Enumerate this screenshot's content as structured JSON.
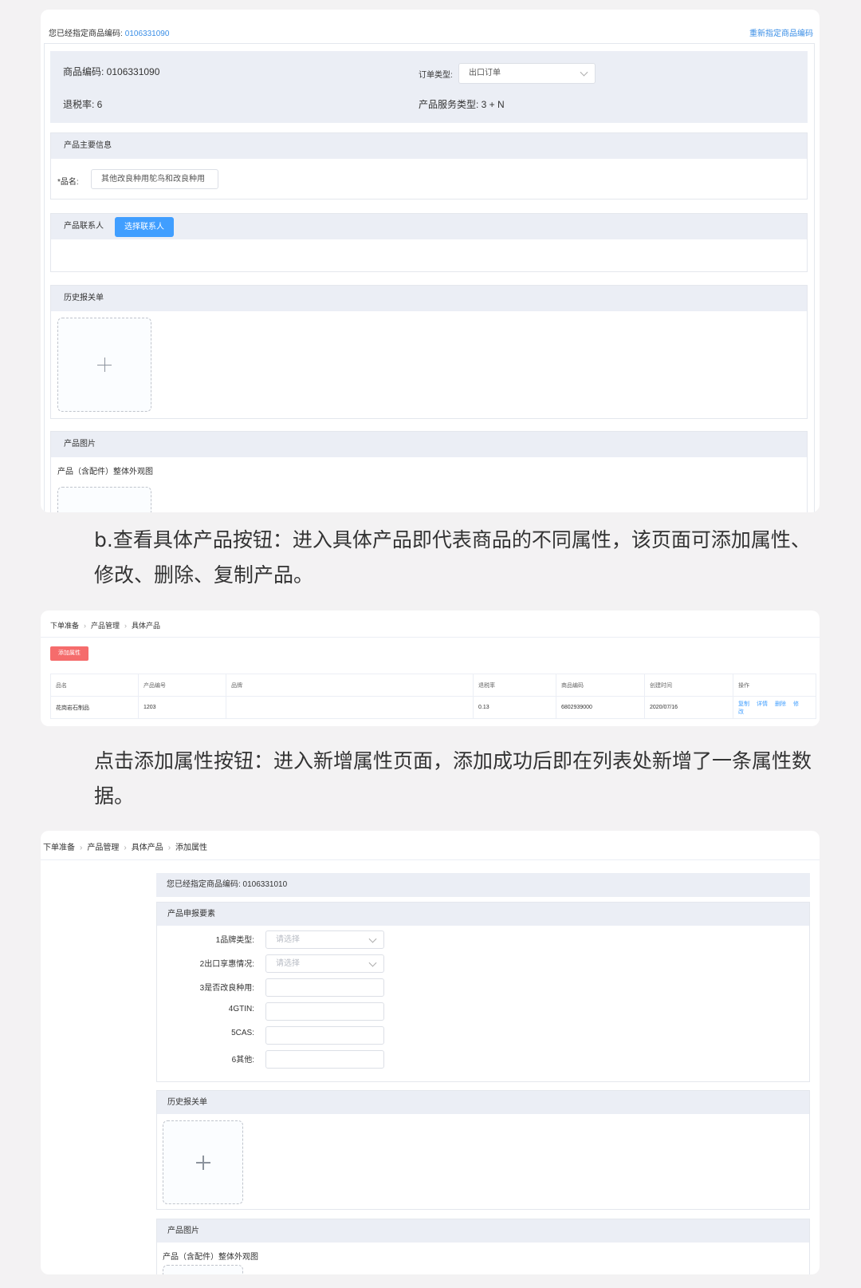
{
  "card1": {
    "assigned_label": "您已经指定商品编码:",
    "assigned_code": "0106331090",
    "reassign_link": "重新指定商品编码",
    "info": {
      "product_code": "商品编码: 0106331090",
      "order_type_label": "订单类型:",
      "order_type_value": "出口订单",
      "tax_rebate": "退税率: 6",
      "service_type": "产品服务类型: 3 + N"
    },
    "main_info": {
      "title": "产品主要信息",
      "name_label": "*品名:",
      "name_value": "其他改良种用鸵鸟和改良种用"
    },
    "contacts": {
      "title": "产品联系人",
      "button": "选择联系人"
    },
    "history": {
      "title": "历史报关单"
    },
    "images": {
      "title": "产品图片",
      "subtitle": "产品（含配件）整体外观图"
    }
  },
  "para1": "b.查看具体产品按钮：进入具体产品即代表商品的不同属性，该页面可添加属性、修改、删除、复制产品。",
  "card2": {
    "breadcrumb": [
      "下单准备",
      "产品管理",
      "具体产品"
    ],
    "add_button": "添加属性",
    "columns": [
      "品名",
      "产品编号",
      "品牌",
      "退税率",
      "商品编码",
      "创建时间",
      "操作"
    ],
    "rows": [
      {
        "name": "花岗岩石制品",
        "number": "1203",
        "brand": "",
        "rebate": "0.13",
        "code": "6802939000",
        "created": "2020/07/16",
        "ops": [
          "复制",
          "详情",
          "删除",
          "修改"
        ]
      }
    ]
  },
  "para2": "点击添加属性按钮：进入新增属性页面，添加成功后即在列表处新增了一条属性数据。",
  "card3": {
    "breadcrumb": [
      "下单准备",
      "产品管理",
      "具体产品",
      "添加属性"
    ],
    "assigned": "您已经指定商品编码: 0106331010",
    "declare_section": "产品申报要素",
    "fields": [
      {
        "label": "1品牌类型:",
        "type": "select",
        "placeholder": "请选择"
      },
      {
        "label": "2出口享惠情况:",
        "type": "select",
        "placeholder": "请选择"
      },
      {
        "label": "3是否改良种用:",
        "type": "input",
        "placeholder": ""
      },
      {
        "label": "4GTIN:",
        "type": "input",
        "placeholder": ""
      },
      {
        "label": "5CAS:",
        "type": "input",
        "placeholder": ""
      },
      {
        "label": "6其他:",
        "type": "input",
        "placeholder": ""
      }
    ],
    "history": "历史报关单",
    "images": "产品图片",
    "images_sub": "产品（含配件）整体外观图"
  }
}
